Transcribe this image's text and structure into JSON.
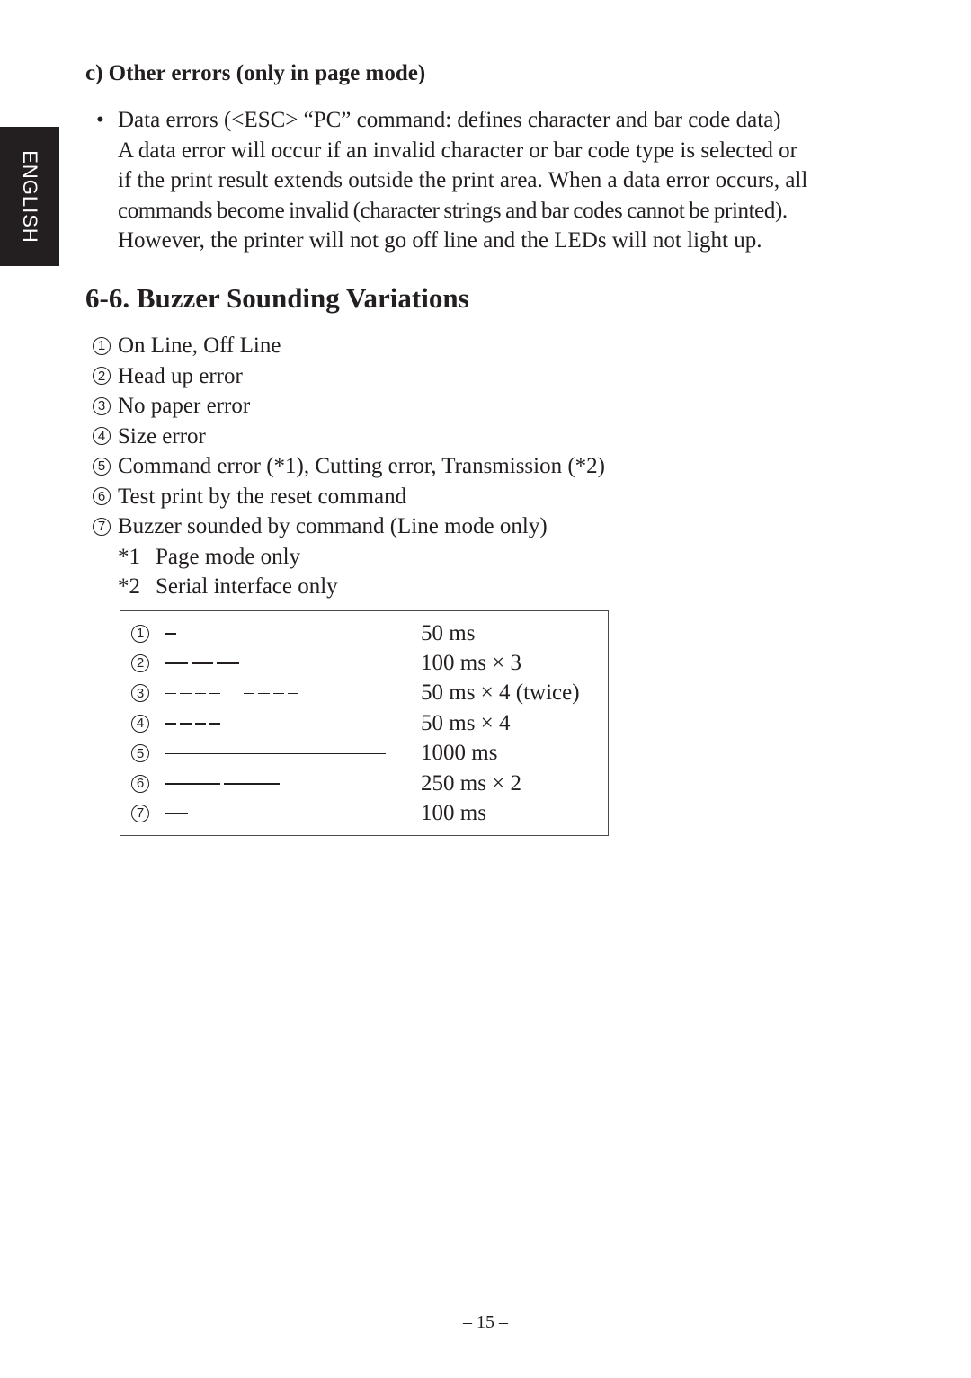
{
  "side_tab": {
    "label": "ENGLISH"
  },
  "subsection": {
    "heading": "c) Other errors (only in page mode)",
    "bullet_symbol": "•",
    "bullet_lines": [
      "Data errors (<ESC> “PC” command: defines character and bar code data)",
      "A data error will occur if an invalid character or bar code type is selected or",
      "if the print result extends outside the print area. When a data error occurs, all",
      "commands become invalid (character strings and bar codes cannot be printed).",
      "However, the printer will not go off line and the LEDs will not light up."
    ]
  },
  "section": {
    "title": "6-6. Buzzer Sounding Variations",
    "items": [
      {
        "num": "1",
        "text": "On Line, Off Line"
      },
      {
        "num": "2",
        "text": "Head up error"
      },
      {
        "num": "3",
        "text": "No paper error"
      },
      {
        "num": "4",
        "text": "Size error"
      },
      {
        "num": "5",
        "text": "Command error (*1), Cutting error, Transmission (*2)"
      },
      {
        "num": "6",
        "text": "Test print by the reset command"
      },
      {
        "num": "7",
        "text": "Buzzer sounded by command (Line mode only)"
      }
    ],
    "notes": [
      {
        "mark": "*1",
        "text": "Page mode only"
      },
      {
        "mark": "*2",
        "text": "Serial interface only"
      }
    ]
  },
  "buzzer_table": {
    "rows": [
      {
        "num": "1",
        "duration": "50 ms",
        "beep_ms": 50,
        "count": 1,
        "groups": 1
      },
      {
        "num": "2",
        "duration": "100 ms × 3",
        "beep_ms": 100,
        "count": 3,
        "groups": 1
      },
      {
        "num": "3",
        "duration": "50 ms × 4 (twice)",
        "beep_ms": 50,
        "count": 4,
        "groups": 2
      },
      {
        "num": "4",
        "duration": "50 ms × 4",
        "beep_ms": 50,
        "count": 4,
        "groups": 1
      },
      {
        "num": "5",
        "duration": "1000 ms",
        "beep_ms": 1000,
        "count": 1,
        "groups": 1
      },
      {
        "num": "6",
        "duration": "250 ms × 2",
        "beep_ms": 250,
        "count": 2,
        "groups": 1
      },
      {
        "num": "7",
        "duration": "100 ms",
        "beep_ms": 100,
        "count": 1,
        "groups": 1
      }
    ]
  },
  "footer": {
    "page_number": "– 15 –"
  }
}
